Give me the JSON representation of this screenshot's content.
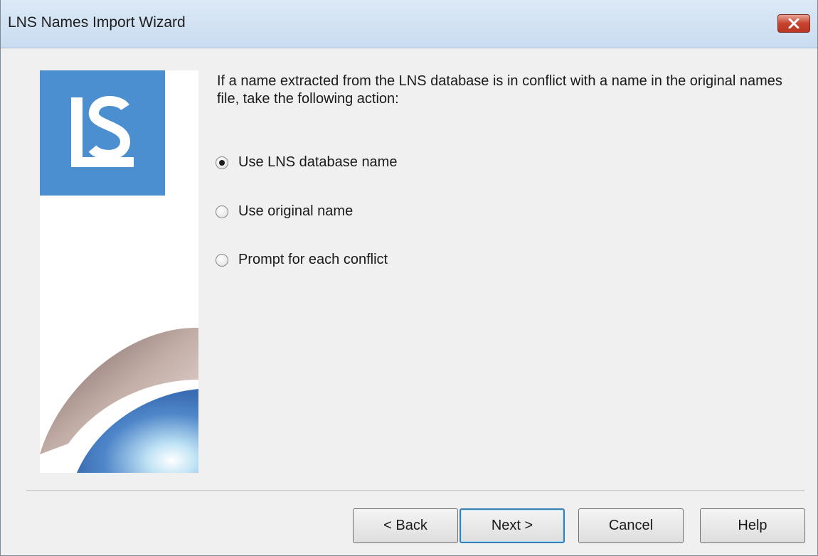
{
  "window": {
    "title": "LNS Names Import Wizard"
  },
  "banner": {
    "logo_text": "LS",
    "colors": {
      "logo_blue": "#4b8fd0"
    }
  },
  "content": {
    "instruction": "If a name extracted from the LNS database is in conflict with a name in the original names file, take the following action:",
    "options": [
      {
        "label": "Use LNS database name",
        "selected": true
      },
      {
        "label": "Use original name",
        "selected": false
      },
      {
        "label": "Prompt for each conflict",
        "selected": false
      }
    ]
  },
  "buttons": {
    "back": "< Back",
    "next": "Next >",
    "cancel": "Cancel",
    "help": "Help"
  }
}
